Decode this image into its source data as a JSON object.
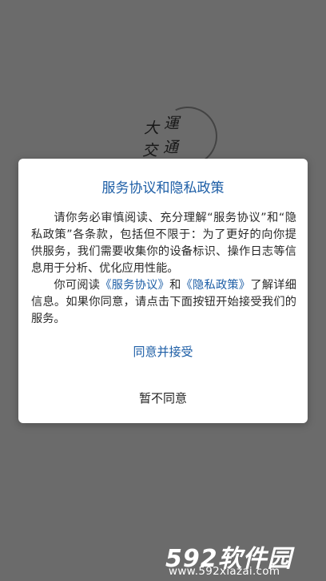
{
  "splash": {
    "logo_chars": [
      "大",
      "運",
      "交",
      "通"
    ]
  },
  "dialog": {
    "title": "服务协议和隐私政策",
    "paragraph1": "请你务必审慎阅读、充分理解“服务协议”和“隐私政策”各条款，包括但不限于：为了更好的向你提供服务，我们需要收集你的设备标识、操作日志等信息用于分析、优化应用性能。",
    "p2_prefix": "你可阅读",
    "link_service": "《服务协议》",
    "p2_and": "和",
    "link_privacy": "《隐私政策》",
    "p2_suffix": "了解详细信息。如果你同意，请点击下面按钮开始接受我们的服务。",
    "agree_label": "同意并接受",
    "disagree_label": "暂不同意"
  },
  "watermark": {
    "logo_text": "592软件园",
    "url": "www.592xiazai.com"
  }
}
